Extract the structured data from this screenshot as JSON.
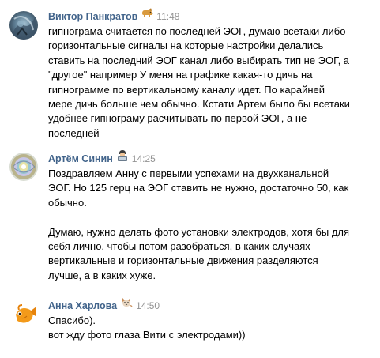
{
  "messages": [
    {
      "author": "Виктор Панкратов",
      "emoji": "dog-icon",
      "time": "11:48",
      "text": "гипнограма считается по последней ЭОГ, думаю всетаки либо\nгоризонтальные сигналы на которые настройки делались\nставить на последний ЭОГ канал либо выбирать тип не ЭОГ, а\n\"другое\" например У меня на графике какая-то дичь на\nгипнограмме по вертикальному каналу идет. По карайней\nмере дичь больше чем обычно. Кстати Артем было бы всетаки\nудобнее гипнограму расчитывать по первой ЭОГ, а не\nпоследней"
    },
    {
      "author": "Артём Синин",
      "emoji": "man-technologist-icon",
      "time": "14:25",
      "text": "Поздравляем Анну с первыми успехами на двухканальной\nЭОГ. Но 125 герц на ЭОГ ставить не нужно, достаточно 50, как\nобычно.\n\nДумаю, нужно делать фото установки электродов, хотя бы для\nсебя лично, чтобы потом разобраться, в каких случаях\nвертикальные и горизонтальные движения разделяются\nлучше, а в каких хуже."
    },
    {
      "author": "Анна Харлова",
      "emoji": "cat-icon",
      "time": "14:50",
      "text": "Спасибо).\nвот жду фото глаза Вити с электродами))"
    }
  ]
}
